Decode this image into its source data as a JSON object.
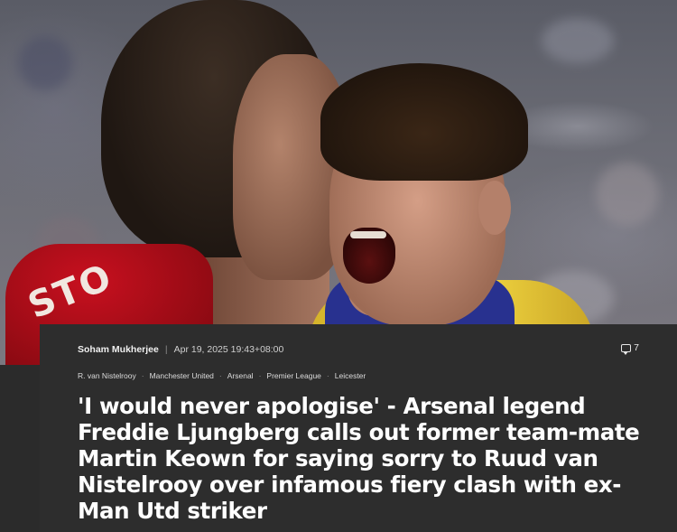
{
  "article": {
    "author": "Soham Mukherjee",
    "meta_separator": "|",
    "date": "Apr 19, 2025 19:43+08:00",
    "comment_count": "7",
    "tags": [
      "R. van Nistelrooy",
      "Manchester United",
      "Arsenal",
      "Premier League",
      "Leicester"
    ],
    "tag_separator": "·",
    "headline": "'I would never apologise' - Arsenal legend Freddie Ljungberg calls out former team-mate Martin Keown for saying sorry to Ruud van Nistelrooy over infamous fiery clash with ex-Man Utd striker"
  },
  "hero": {
    "shirt_lettering": "STO"
  },
  "colors": {
    "card_background": "#2d2d2d",
    "page_background": "#2b2b2b",
    "headline_text": "#ffffff",
    "meta_text": "#d9d9d9"
  },
  "icons": {
    "comments": "comment-bubble-icon"
  }
}
